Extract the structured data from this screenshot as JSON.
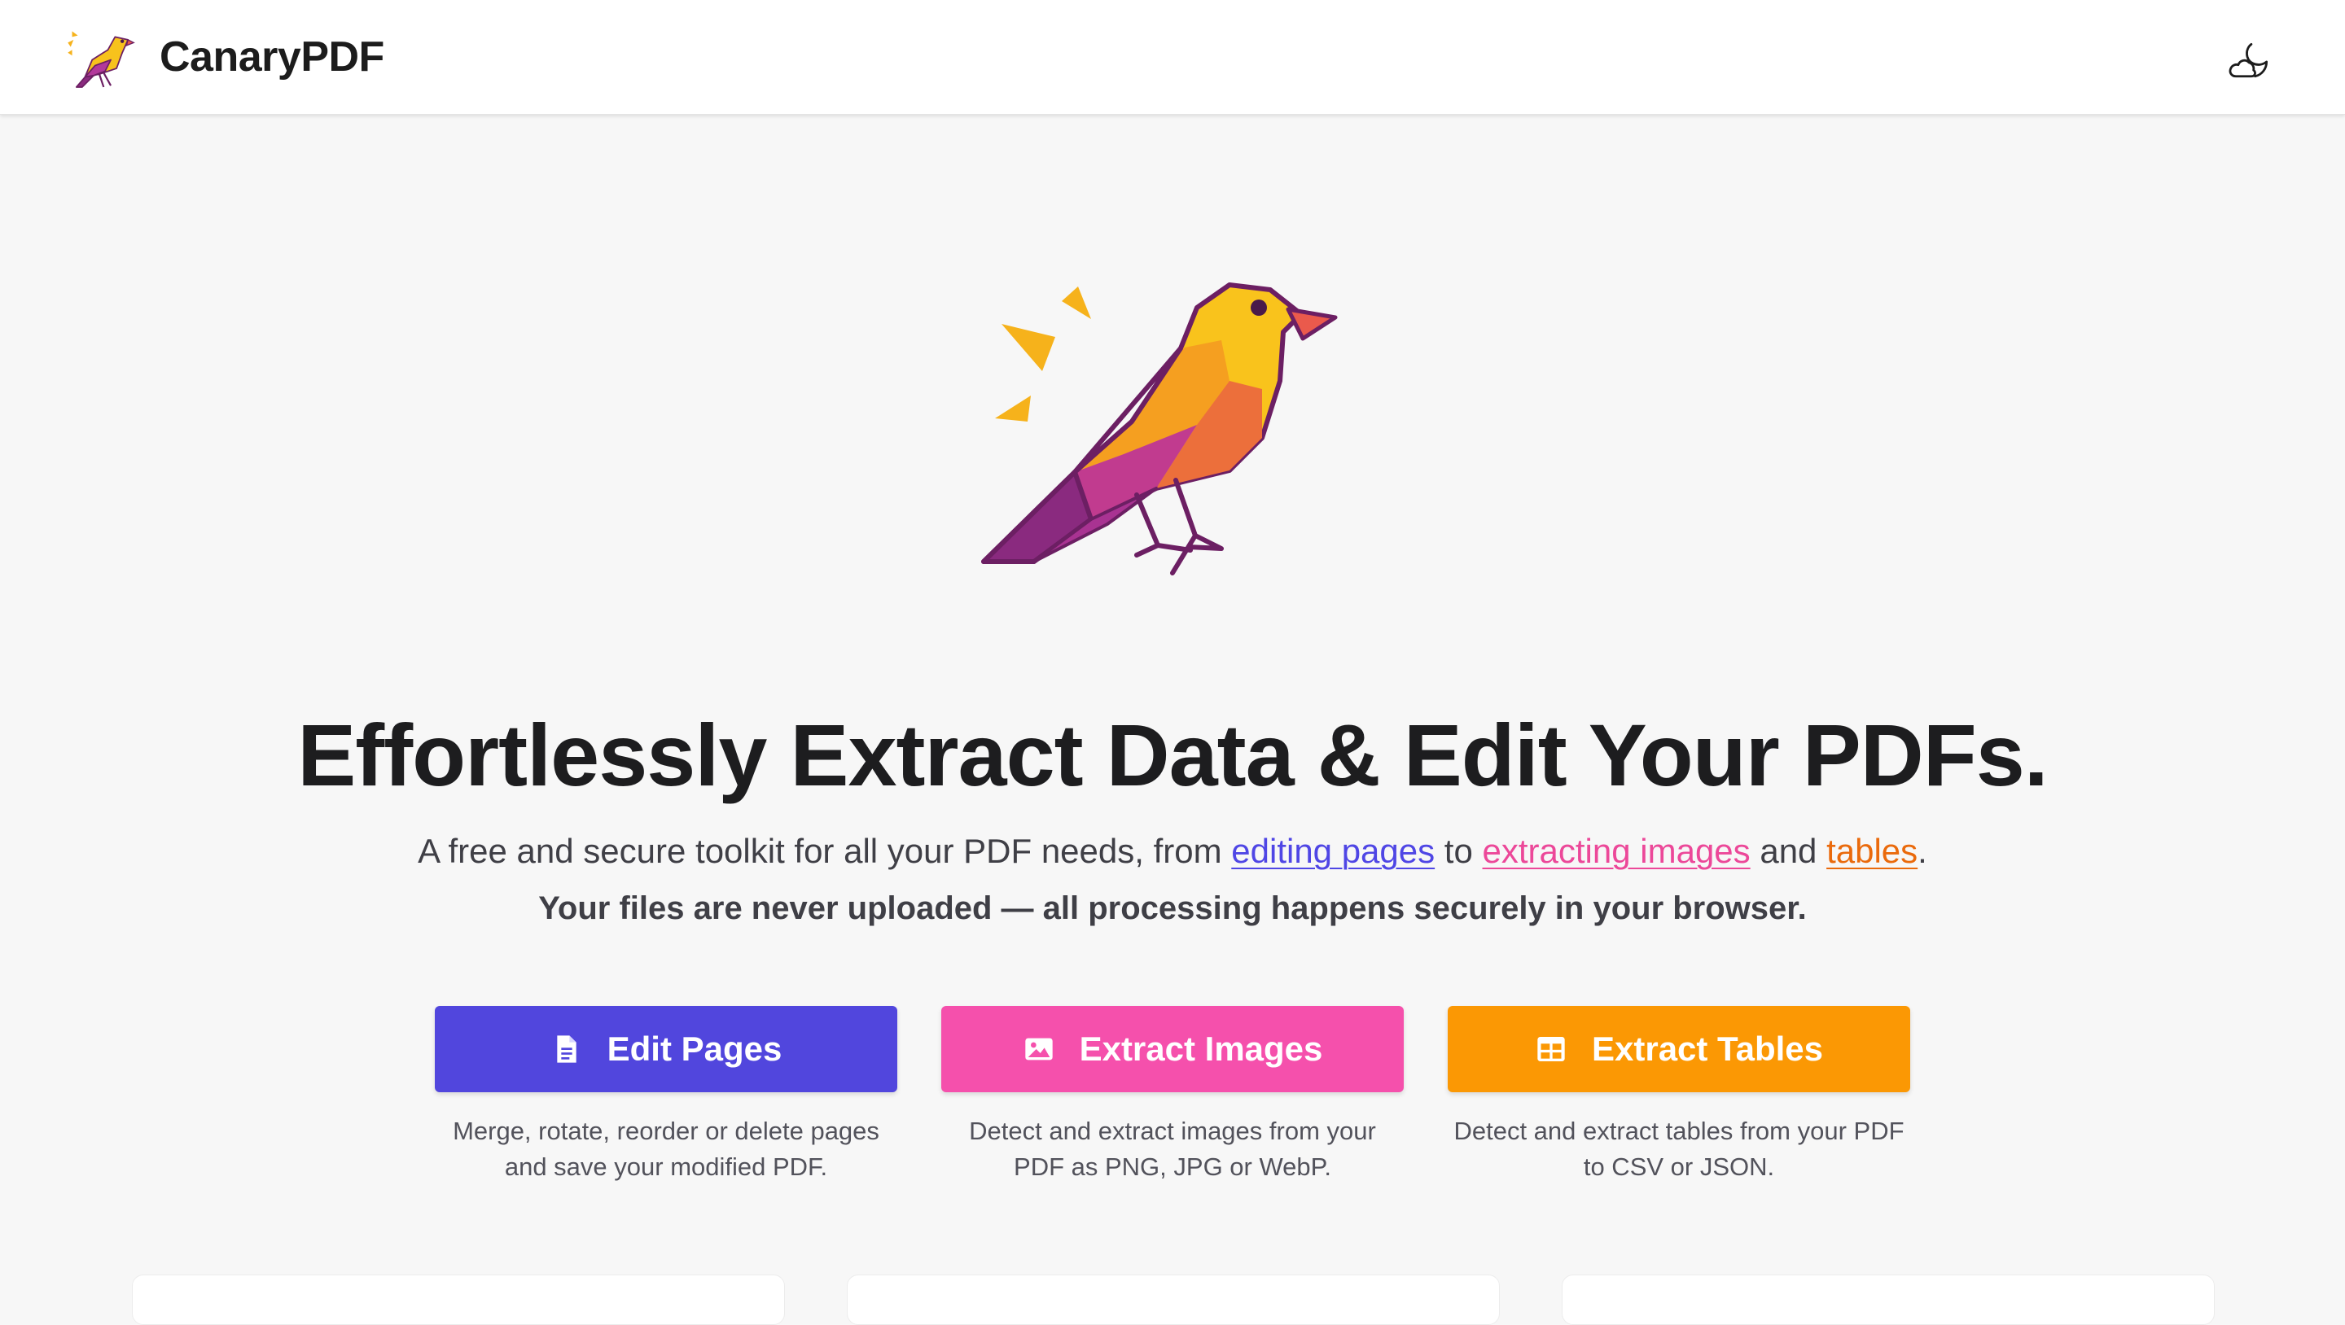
{
  "app": {
    "name": "CanaryPDF",
    "logo_icon": "canary-bird-logo",
    "theme_toggle_icon": "moon-cloud-icon"
  },
  "hero": {
    "illustration": "canary-bird-illustration",
    "headline": "Effortlessly Extract Data & Edit Your PDFs.",
    "tagline": {
      "prefix": "A free and secure toolkit for all your PDF needs, from ",
      "link_edit": "editing pages",
      "middle1": " to ",
      "link_images": "extracting images",
      "middle2": " and ",
      "link_tables": "tables",
      "suffix": "."
    },
    "privacy_note": "Your files are never uploaded — all processing happens securely in your browser."
  },
  "tools": [
    {
      "label": "Edit Pages",
      "icon": "document-icon",
      "color": "#5146dd",
      "description": "Merge, rotate, reorder or delete pages and save your modified PDF."
    },
    {
      "label": "Extract Images",
      "icon": "image-icon",
      "color": "#f550ac",
      "description": "Detect and extract images from your PDF as PNG, JPG or WebP."
    },
    {
      "label": "Extract Tables",
      "icon": "table-icon",
      "color": "#fb9804",
      "description": "Detect and extract tables from your PDF to CSV or JSON."
    }
  ],
  "colors": {
    "link_edit": "#4f46e5",
    "link_images": "#ec4899",
    "link_tables": "#ea6a0c",
    "background": "#f7f7f7"
  }
}
